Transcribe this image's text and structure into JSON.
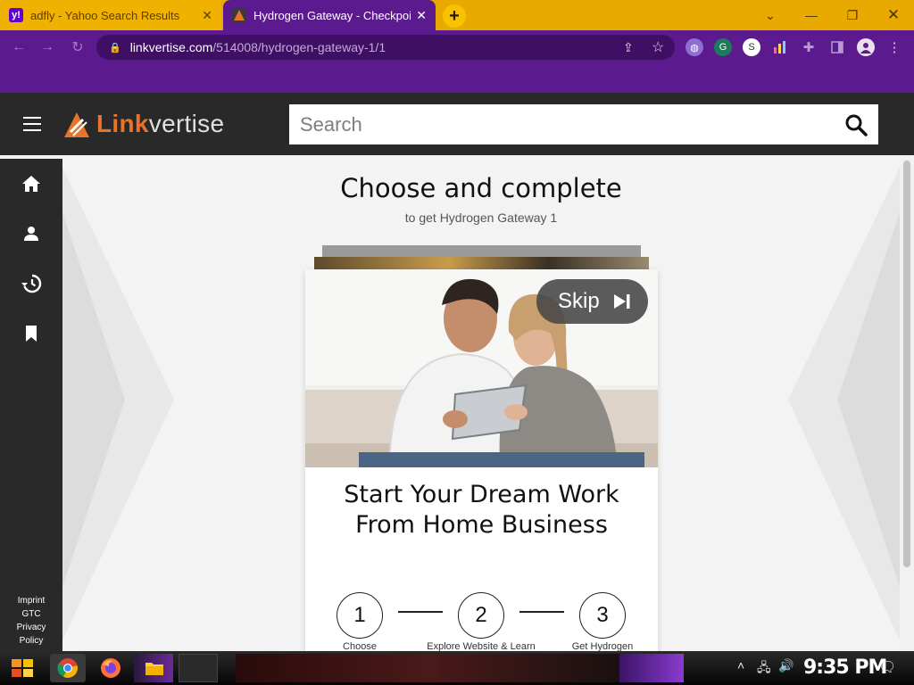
{
  "browser": {
    "tabs": [
      {
        "title": "adfly - Yahoo Search Results",
        "favicon": "y!",
        "active": false
      },
      {
        "title": "Hydrogen Gateway - Checkpoin",
        "active": true
      }
    ],
    "new_tab_label": "+",
    "url_host": "linkvertise.com",
    "url_path": "/514008/hydrogen-gateway-1/1",
    "window_controls": [
      "chevron-down",
      "minimize",
      "restore",
      "close"
    ],
    "colors": {
      "tab_strip": "#e8a900",
      "toolbar": "#5c1a8f"
    }
  },
  "site": {
    "logo_primary": "Link",
    "logo_secondary": "vertise",
    "search_placeholder": "Search",
    "colors": {
      "header": "#292929",
      "brand_orange": "#e8742a"
    }
  },
  "sidebar": {
    "icons": [
      "home-icon",
      "user-icon",
      "history-icon",
      "bookmark-icon"
    ],
    "links": [
      "Imprint",
      "GTC",
      "Privacy",
      "Policy"
    ]
  },
  "main": {
    "headline": "Choose and complete",
    "subline": "to get Hydrogen Gateway 1",
    "card": {
      "skip_label": "Skip",
      "title_line1": "Start Your Dream Work",
      "title_line2": "From Home Business"
    },
    "steps": [
      {
        "number": "1",
        "label": "Choose"
      },
      {
        "number": "2",
        "label": "Explore Website & Learn"
      },
      {
        "number": "3",
        "label": "Get Hydrogen"
      }
    ]
  },
  "taskbar": {
    "clock": "9:35 PM"
  }
}
